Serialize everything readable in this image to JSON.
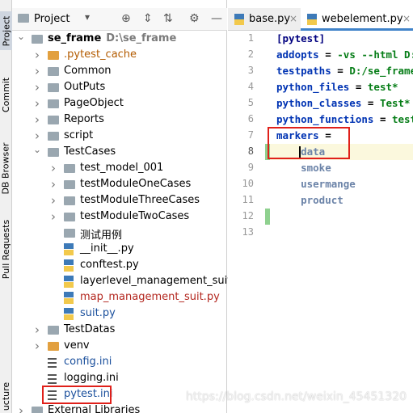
{
  "side_tabs": {
    "project": "Project",
    "commit": "Commit",
    "db_browser": "DB Browser",
    "pull_requests": "Pull Requests",
    "structure": "ucture"
  },
  "project_panel": {
    "title": "Project",
    "caret": "▾",
    "toolbar": {
      "add": "⊕",
      "collapse": "⇅",
      "expand": "⇕",
      "settings": "⚙",
      "hide": "—"
    }
  },
  "tree": [
    {
      "label": "se_frame",
      "path": "D:\\se_frame",
      "type": "folder",
      "depth": 0,
      "expanded": true,
      "bold": true
    },
    {
      "label": ".pytest_cache",
      "type": "folder-orange",
      "depth": 1,
      "expanded": false,
      "color": "#b35b00"
    },
    {
      "label": "Common",
      "type": "folder",
      "depth": 1,
      "expanded": false
    },
    {
      "label": "OutPuts",
      "type": "folder",
      "depth": 1,
      "expanded": false
    },
    {
      "label": "PageObject",
      "type": "folder",
      "depth": 1,
      "expanded": false
    },
    {
      "label": "Reports",
      "type": "folder",
      "depth": 1,
      "expanded": false
    },
    {
      "label": "script",
      "type": "folder",
      "depth": 1,
      "expanded": false
    },
    {
      "label": "TestCases",
      "type": "folder",
      "depth": 1,
      "expanded": true
    },
    {
      "label": "test_model_001",
      "type": "folder",
      "depth": 2,
      "expanded": false
    },
    {
      "label": "testModuleOneCases",
      "type": "folder",
      "depth": 2,
      "expanded": false
    },
    {
      "label": "testModuleThreeCases",
      "type": "folder",
      "depth": 2,
      "expanded": false
    },
    {
      "label": "testModuleTwoCases",
      "type": "folder",
      "depth": 2,
      "expanded": false
    },
    {
      "label": "测试用例",
      "type": "folder",
      "depth": 2,
      "leaf": true
    },
    {
      "label": "__init__.py",
      "type": "py",
      "depth": 2,
      "leaf": true
    },
    {
      "label": "conftest.py",
      "type": "py",
      "depth": 2,
      "leaf": true
    },
    {
      "label": "layerlevel_management_suit.py",
      "type": "py",
      "depth": 2,
      "leaf": true
    },
    {
      "label": "map_management_suit.py",
      "type": "py",
      "depth": 2,
      "leaf": true,
      "color": "#b3261e"
    },
    {
      "label": "suit.py",
      "type": "py",
      "depth": 2,
      "leaf": true,
      "color": "#1a4f9c"
    },
    {
      "label": "TestDatas",
      "type": "folder",
      "depth": 1,
      "expanded": false
    },
    {
      "label": "venv",
      "type": "folder-orange",
      "depth": 1,
      "expanded": false
    },
    {
      "label": "config.ini",
      "type": "ini",
      "depth": 1,
      "leaf": true,
      "color": "#1a4f9c"
    },
    {
      "label": "logging.ini",
      "type": "ini",
      "depth": 1,
      "leaf": true
    },
    {
      "label": "pytest.ini",
      "type": "ini",
      "depth": 1,
      "leaf": true,
      "color": "#1a4f9c",
      "highlighted": true
    },
    {
      "label": "External Libraries",
      "type": "lib",
      "depth": 0,
      "expanded": false
    }
  ],
  "editor": {
    "tabs": [
      {
        "label": "base.py",
        "active": false,
        "close": "×"
      },
      {
        "label": "webelement.py",
        "active": true,
        "close": "×"
      }
    ],
    "line_numbers": [
      "1",
      "2",
      "3",
      "4",
      "5",
      "6",
      "7",
      "8",
      "9",
      "10",
      "11",
      "12",
      "13"
    ],
    "current_line": 8,
    "lines": [
      [
        {
          "t": "[pytest]",
          "c": "k-sec"
        }
      ],
      [
        {
          "t": "addopts",
          "c": "k-key"
        },
        {
          "t": " = ",
          "c": "k-op"
        },
        {
          "t": "-vs --html D:/",
          "c": "k-val"
        }
      ],
      [
        {
          "t": "testpaths",
          "c": "k-key"
        },
        {
          "t": " = ",
          "c": "k-op"
        },
        {
          "t": "D:/se_frame/",
          "c": "k-val"
        }
      ],
      [
        {
          "t": "python_files",
          "c": "k-key"
        },
        {
          "t": " = ",
          "c": "k-op"
        },
        {
          "t": "test*",
          "c": "k-val"
        }
      ],
      [
        {
          "t": "python_classes",
          "c": "k-key"
        },
        {
          "t": " = ",
          "c": "k-op"
        },
        {
          "t": "Test*",
          "c": "k-val"
        }
      ],
      [
        {
          "t": "python_functions",
          "c": "k-key"
        },
        {
          "t": " = ",
          "c": "k-op"
        },
        {
          "t": "test*",
          "c": "k-val"
        }
      ],
      [
        {
          "t": "markers",
          "c": "k-key"
        },
        {
          "t": " =",
          "c": "k-op"
        }
      ],
      [
        {
          "t": "    data",
          "c": "k-list"
        }
      ],
      [
        {
          "t": "    smoke",
          "c": "k-list"
        }
      ],
      [
        {
          "t": "    usermange",
          "c": "k-list"
        }
      ],
      [
        {
          "t": "    product",
          "c": "k-list"
        }
      ],
      [],
      []
    ]
  },
  "watermark": "https://blog.csdn.net/weixin_45451320"
}
